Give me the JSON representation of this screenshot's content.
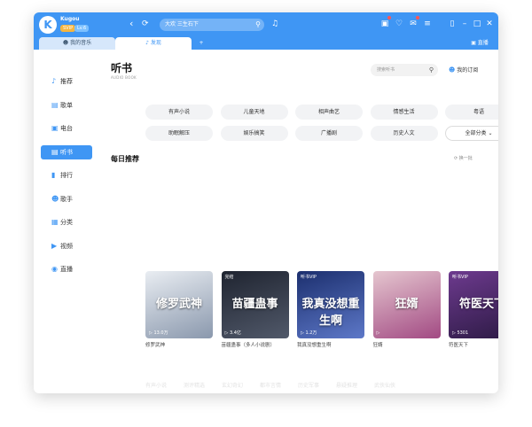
{
  "app": {
    "brand_line1": "Kugou",
    "brand_line2": "Kugou",
    "vip_badge": "SVIP",
    "level_badge": "Lv.6"
  },
  "topbar": {
    "search_placeholder": "大欢 三生石下",
    "icons": [
      "back-icon",
      "refresh-icon",
      "search-icon",
      "mic-icon",
      "skin-icon",
      "vip-icon",
      "mail-icon",
      "menu-icon",
      "mini-player-icon",
      "minimize-icon",
      "maximize-icon",
      "close-icon"
    ]
  },
  "tabs": {
    "my_music": "我的音乐",
    "discover": "发现",
    "listen": "直播"
  },
  "sidebar": {
    "items": [
      {
        "label": "推荐",
        "icon": "recommend-icon"
      },
      {
        "label": "歌单",
        "icon": "playlist-icon"
      },
      {
        "label": "电台",
        "icon": "radio-icon"
      },
      {
        "label": "听书",
        "icon": "audiobook-icon"
      },
      {
        "label": "排行",
        "icon": "ranking-icon"
      },
      {
        "label": "歌手",
        "icon": "singer-icon"
      },
      {
        "label": "分类",
        "icon": "category-icon"
      },
      {
        "label": "视频",
        "icon": "video-icon"
      },
      {
        "label": "直播",
        "icon": "live-icon"
      }
    ],
    "active_index": 3
  },
  "page": {
    "title": "听书",
    "subtitle": "AUDIO BOOK",
    "search_placeholder": "搜索听书",
    "my_subscriptions": "我的订阅"
  },
  "categories": [
    "有声小说",
    "儿童天地",
    "相声曲艺",
    "情感生活",
    "粤语",
    "助眠解压",
    "娱乐搞笑",
    "广播剧",
    "历史人文"
  ],
  "all_categories": "全部分类",
  "daily": {
    "title": "每日推荐",
    "refresh": "换一批"
  },
  "books": [
    {
      "cover_title": "修罗武神",
      "tag": "",
      "plays": "13.0万",
      "name": "修罗武神",
      "colors": [
        "#e9edf2",
        "#8a98ad"
      ]
    },
    {
      "cover_title": "苗疆蛊事",
      "tag": "完结",
      "plays": "3.4亿",
      "name": "苗疆蛊事（多人小说剧）",
      "colors": [
        "#1f2430",
        "#51596a"
      ]
    },
    {
      "cover_title": "我真没想重生啊",
      "tag": "听书VIP",
      "plays": "1.2万",
      "name": "我真没想重生啊",
      "colors": [
        "#1c2f6e",
        "#5d78c8"
      ]
    },
    {
      "cover_title": "狂婿",
      "tag": "",
      "plays": "",
      "name": "狂婿",
      "colors": [
        "#e5c6cf",
        "#a24a83"
      ]
    },
    {
      "cover_title": "符医天下",
      "tag": "听书VIP",
      "plays": "5301",
      "name": "符医天下",
      "colors": [
        "#6d3a8e",
        "#2c1a44"
      ]
    }
  ],
  "faded_row": [
    "有声小说",
    "测评精选",
    "玄幻奇幻",
    "都市言情",
    "历史军事",
    "悬疑推理",
    "武侠仙侠"
  ]
}
